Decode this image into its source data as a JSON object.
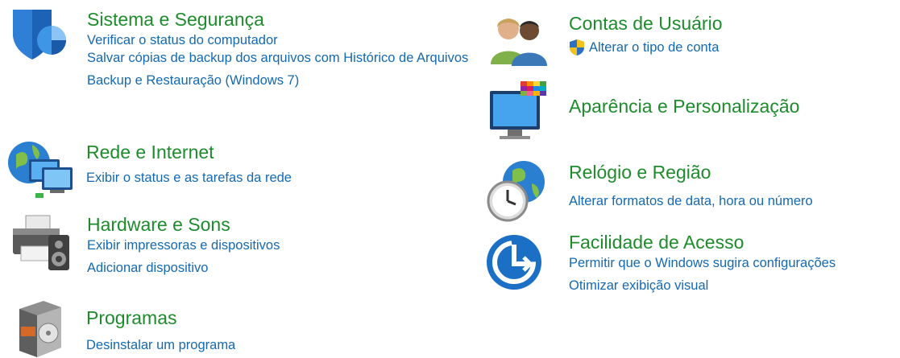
{
  "categories": {
    "sistema": {
      "title": "Sistema e Segurança",
      "links": [
        "Verificar o status do computador",
        "Salvar cópias de backup dos arquivos com Histórico de Arquivos",
        "Backup e Restauração (Windows 7)"
      ]
    },
    "rede": {
      "title": "Rede e Internet",
      "links": [
        "Exibir o status e as tarefas da rede"
      ]
    },
    "hardware": {
      "title": "Hardware e Sons",
      "links": [
        "Exibir impressoras e dispositivos",
        "Adicionar dispositivo"
      ]
    },
    "programas": {
      "title": "Programas",
      "links": [
        "Desinstalar um programa"
      ]
    },
    "contas": {
      "title": "Contas de Usuário",
      "links": [
        "Alterar o tipo de conta"
      ]
    },
    "aparencia": {
      "title": "Aparência e Personalização",
      "links": []
    },
    "relogio": {
      "title": "Relógio e Região",
      "links": [
        "Alterar formatos de data, hora ou número"
      ]
    },
    "facilidade": {
      "title": "Facilidade de Acesso",
      "links": [
        "Permitir que o Windows sugira configurações",
        "Otimizar exibição visual"
      ]
    }
  },
  "colors": {
    "title": "#1e8b2c",
    "link": "#1469b0"
  },
  "icons": [
    "shield-security-icon",
    "network-globe-icon",
    "printer-speaker-icon",
    "programs-box-icon",
    "users-icon",
    "uac-shield-icon",
    "monitor-palette-icon",
    "clock-globe-icon",
    "ease-of-access-icon"
  ]
}
